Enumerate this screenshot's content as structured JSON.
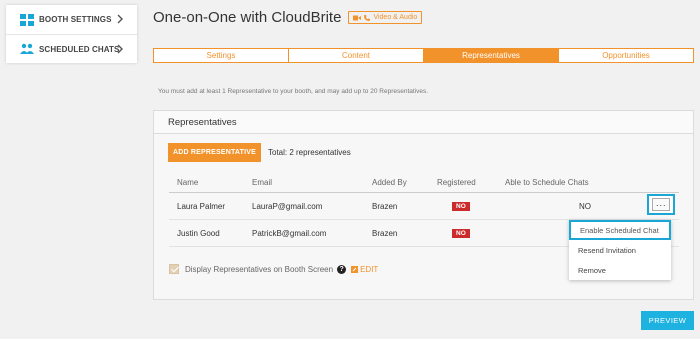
{
  "sidebar": {
    "items": [
      {
        "label": "BOOTH SETTINGS",
        "icon": "grid-icon"
      },
      {
        "label": "SCHEDULED CHATS",
        "icon": "users-icon"
      }
    ]
  },
  "header": {
    "title": "One-on-One with CloudBrite",
    "badge": "Video & Audio"
  },
  "tabs": [
    {
      "label": "Settings",
      "active": false
    },
    {
      "label": "Content",
      "active": false
    },
    {
      "label": "Representatives",
      "active": true
    },
    {
      "label": "Opportunities",
      "active": false
    }
  ],
  "info_text": "You must add at least 1 Representative to your booth, and may add up to 20 Representatives.",
  "panel": {
    "title": "Representatives",
    "add_button": "ADD REPRESENTATIVE",
    "total": "Total: 2 representatives",
    "columns": [
      "Name",
      "Email",
      "Added By",
      "Registered",
      "Able to Schedule Chats"
    ],
    "rows": [
      {
        "name": "Laura Palmer",
        "email": "LauraP@gmail.com",
        "added_by": "Brazen",
        "registered": "NO",
        "schedule": "NO"
      },
      {
        "name": "Justin Good",
        "email": "PatrickB@gmail.com",
        "added_by": "Brazen",
        "registered": "NO",
        "schedule": ""
      }
    ],
    "more_button": "···",
    "display_label": "Display Representatives on Booth Screen",
    "help": "?",
    "edit": "EDIT"
  },
  "menu": {
    "items": [
      "Enable Scheduled Chat",
      "Resend Invitation",
      "Remove"
    ]
  },
  "preview_button": "PREVIEW",
  "colors": {
    "accent": "#f2922b",
    "highlight": "#1aa7d5",
    "danger": "#cc2b2b",
    "preview": "#1eb2e1"
  }
}
